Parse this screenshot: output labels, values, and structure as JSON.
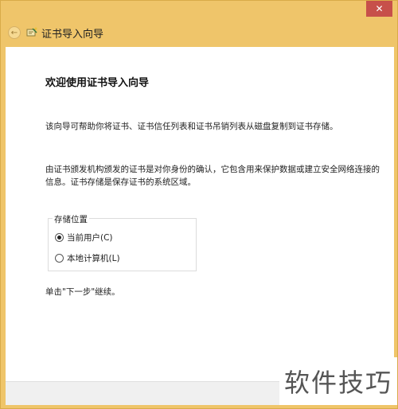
{
  "window": {
    "close_label": "✕",
    "back_label": "←"
  },
  "header": {
    "title": "证书导入向导"
  },
  "main": {
    "page_title": "欢迎使用证书导入向导",
    "intro_text": "该向导可帮助你将证书、证书信任列表和证书吊销列表从磁盘复制到证书存储。",
    "info_text": "由证书颁发机构颁发的证书是对你身份的确认，它包含用来保护数据或建立安全网络连接的信息。证书存储是保存证书的系统区域。",
    "store_location": {
      "legend": "存储位置",
      "options": [
        {
          "label": "当前用户(C)",
          "selected": true
        },
        {
          "label": "本地计算机(L)",
          "selected": false
        }
      ]
    },
    "continue_text": "单击\"下一步\"继续。"
  },
  "watermark": {
    "text": "软件技巧"
  },
  "colors": {
    "frame": "#efc56a",
    "close": "#c7504a",
    "content": "#ffffff",
    "footer": "#f0f0f0"
  }
}
